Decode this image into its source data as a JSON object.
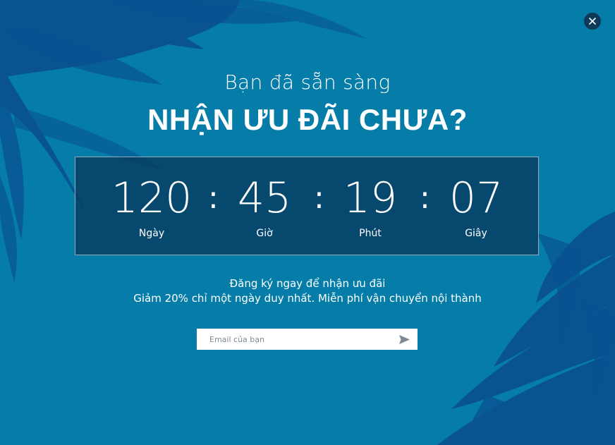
{
  "popup": {
    "subtitle": "Bạn đã sẵn sàng",
    "title": "NHẬN ƯU ĐÃI CHƯA?"
  },
  "countdown": {
    "separator": ":",
    "units": [
      {
        "value": "120",
        "label": "Ngày"
      },
      {
        "value": "45",
        "label": "Giờ"
      },
      {
        "value": "19",
        "label": "Phút"
      },
      {
        "value": "07",
        "label": "Giây"
      }
    ]
  },
  "info": {
    "line1": "Đăng ký ngay để nhận ưu đãi",
    "line2": "Giảm 20% chỉ một ngày duy nhất. Miễn phí vận chuyển nội thành"
  },
  "form": {
    "email_placeholder": "Email của bạn",
    "submit_icon": "send-icon"
  },
  "icons": {
    "close": "close-icon",
    "send": "send-icon"
  },
  "colors": {
    "background": "#057da8",
    "leaf_dark": "#0a4a8a",
    "countdown_panel": "#093557",
    "close_button": "#0c3a57"
  }
}
